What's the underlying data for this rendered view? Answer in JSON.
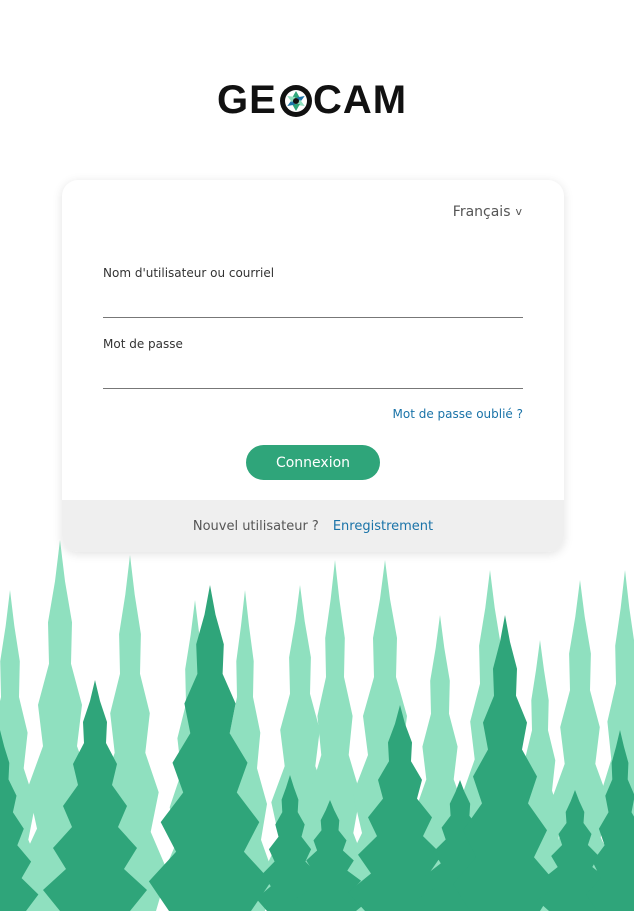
{
  "brand": {
    "logo_left": "GE",
    "logo_right": "CAM",
    "colors": {
      "accent": "#2fa57a",
      "link": "#1a73a8",
      "tree_light": "#8fe0bf",
      "tree_dark": "#2fa57a"
    }
  },
  "login": {
    "language_label": "Français",
    "language_icon": "chevron-down-icon",
    "username_label": "Nom d'utilisateur ou courriel",
    "username_value": "",
    "password_label": "Mot de passe",
    "password_value": "",
    "forgot_label": "Mot de passe oublié ?",
    "submit_label": "Connexion"
  },
  "footer": {
    "new_user_text": "Nouvel utilisateur ?",
    "register_label": "Enregistrement"
  }
}
